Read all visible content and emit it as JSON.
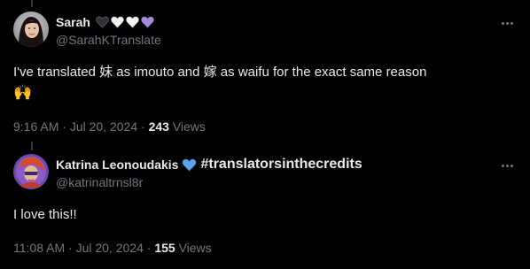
{
  "tweet1": {
    "display_name": "Sarah",
    "hearts": [
      {
        "name": "black-heart-icon",
        "color": "#2f3336"
      },
      {
        "name": "white-heart-icon",
        "color": "#f5f5f5"
      },
      {
        "name": "white-heart-icon",
        "color": "#f5f5f5"
      },
      {
        "name": "purple-heart-icon",
        "color": "#a78bdb"
      }
    ],
    "handle": "@SarahKTranslate",
    "text": "I've translated 妹 as imouto and 嫁 as waifu for the exact same reason",
    "emoji": "🙌",
    "time": "9:16 AM",
    "sep": "·",
    "date": "Jul 20, 2024",
    "views_count": "243",
    "views_label": "Views"
  },
  "tweet2": {
    "display_name": "Katrina Leonoudakis",
    "verified_icon": "blue-heart-icon",
    "verified_color": "#5ba4e8",
    "hashtag": "#translatorsinthecredits",
    "handle": "@katrinaltrnsl8r",
    "text": "I love this!!",
    "time": "11:08 AM",
    "sep": "·",
    "date": "Jul 20, 2024",
    "views_count": "155",
    "views_label": "Views"
  },
  "colors": {
    "background": "#000000",
    "text": "#e7e9ea",
    "secondary_text": "#71767b",
    "thread_line": "#333639"
  }
}
